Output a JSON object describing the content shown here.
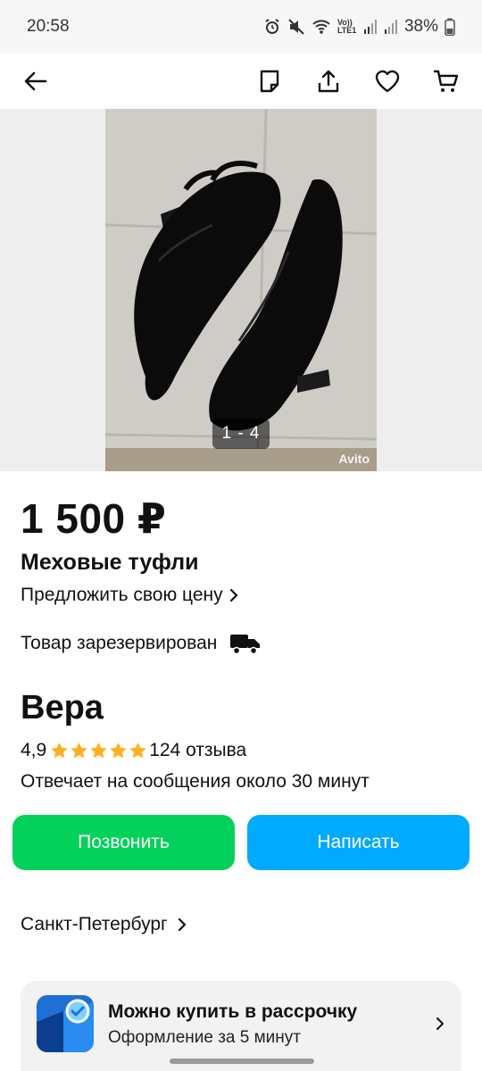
{
  "status_bar": {
    "time": "20:58",
    "network": "Vo)) LTE1",
    "battery": "38%"
  },
  "app_bar": {
    "icons": [
      "back-arrow-icon",
      "note-icon",
      "share-icon",
      "heart-icon",
      "cart-icon"
    ]
  },
  "gallery": {
    "counter": "1 - 4",
    "watermark": "Avito"
  },
  "listing": {
    "price": "1 500 ₽",
    "title": "Меховые туфли",
    "offer_price": "Предложить свою цену",
    "reserved": "Товар зарезервирован"
  },
  "seller": {
    "name": "Вера",
    "rating": "4,9",
    "stars": 5,
    "reviews": "124 отзыва",
    "response_time": "Отвечает на сообщения около 30 минут"
  },
  "actions": {
    "call": "Позвонить",
    "write": "Написать"
  },
  "location": {
    "city": "Санкт-Петербург"
  },
  "installment": {
    "title": "Можно купить в рассрочку",
    "subtitle": "Оформление за 5 минут"
  },
  "colors": {
    "call_button": "#02d15c",
    "write_button": "#00aaff",
    "star": "#ffb021"
  }
}
